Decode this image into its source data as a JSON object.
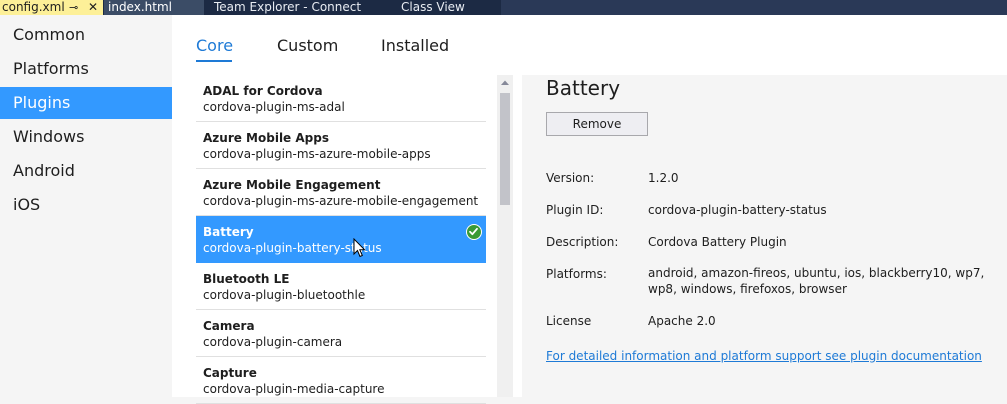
{
  "doc_tabs": {
    "active": {
      "label": "config.xml",
      "pin": "⊸",
      "close": "✕"
    },
    "tabs": [
      "index.html",
      "Team Explorer - Connect",
      "Class View"
    ]
  },
  "nav": {
    "items": [
      "Common",
      "Platforms",
      "Plugins",
      "Windows",
      "Android",
      "iOS"
    ],
    "selected": "Plugins"
  },
  "subtabs": {
    "items": [
      "Core",
      "Custom",
      "Installed"
    ],
    "selected": "Core"
  },
  "plugins": [
    {
      "name": "ADAL for Cordova",
      "package": "cordova-plugin-ms-adal"
    },
    {
      "name": "Azure Mobile Apps",
      "package": "cordova-plugin-ms-azure-mobile-apps"
    },
    {
      "name": "Azure Mobile Engagement",
      "package": "cordova-plugin-ms-azure-mobile-engagement"
    },
    {
      "name": "Battery",
      "package": "cordova-plugin-battery-status",
      "selected": true,
      "installed": true
    },
    {
      "name": "Bluetooth LE",
      "package": "cordova-plugin-bluetoothle"
    },
    {
      "name": "Camera",
      "package": "cordova-plugin-camera"
    },
    {
      "name": "Capture",
      "package": "cordova-plugin-media-capture"
    }
  ],
  "details": {
    "title": "Battery",
    "remove_label": "Remove",
    "version_label": "Version:",
    "version": "1.2.0",
    "plugin_id_label": "Plugin ID:",
    "plugin_id": "cordova-plugin-battery-status",
    "description_label": "Description:",
    "description": "Cordova Battery Plugin",
    "platforms_label": "Platforms:",
    "platforms": "android, amazon-fireos, ubuntu, ios, blackberry10, wp7, wp8, windows, firefoxos, browser",
    "license_label": "License",
    "license": "Apache 2.0",
    "doc_link": "For detailed information and platform support see plugin documentation"
  },
  "colors": {
    "accent": "#3399ff",
    "link": "#1e7ad6",
    "installed_check": "#3a9a36",
    "active_tab": "#fdf098",
    "tabstrip": "#1c2a44"
  },
  "icons": {
    "pin": "pin-icon",
    "close": "close-icon",
    "installed": "check-circle-icon",
    "scroll_up": "chevron-up-icon",
    "cursor": "mouse-cursor-icon"
  }
}
